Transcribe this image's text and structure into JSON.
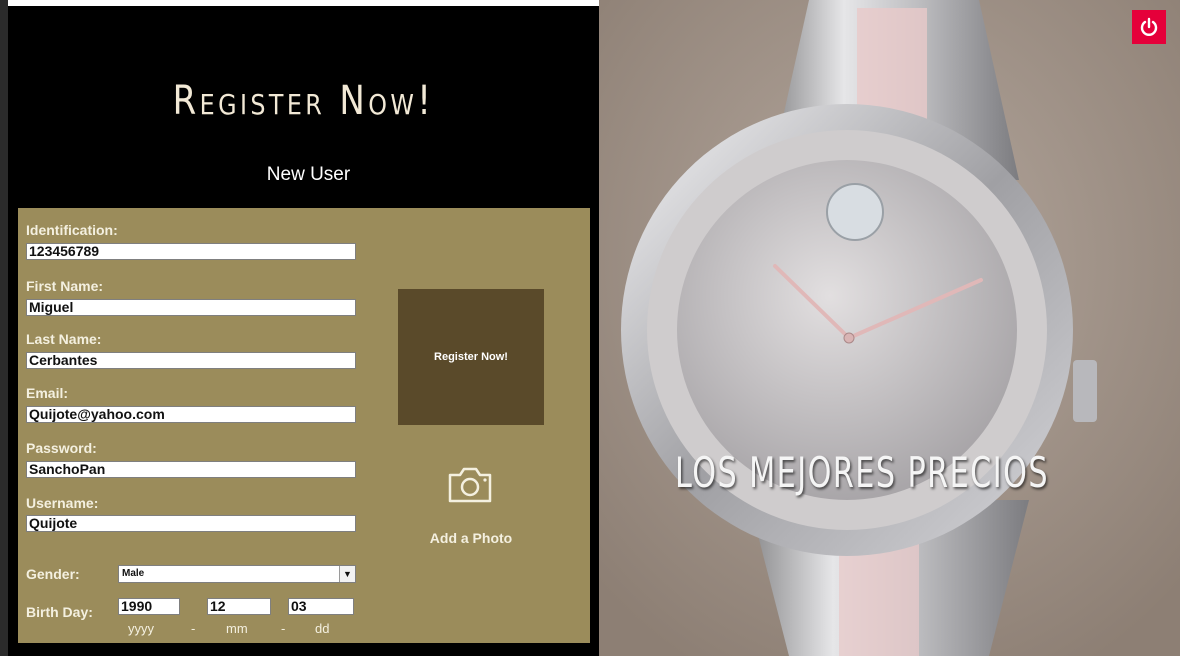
{
  "title": "Register Now!",
  "subtitle": "New User",
  "form": {
    "fields": [
      {
        "label": "Identification:",
        "value": "123456789"
      },
      {
        "label": "First Name:",
        "value": "Miguel"
      },
      {
        "label": "Last Name:",
        "value": "Cerbantes"
      },
      {
        "label": "Email:",
        "value": "Quijote@yahoo.com"
      },
      {
        "label": "Password:",
        "value": "SanchoPan"
      },
      {
        "label": "Username:",
        "value": "Quijote"
      }
    ],
    "gender": {
      "label": "Gender:",
      "value": "Male"
    },
    "birthday": {
      "label": "Birth Day:",
      "year": "1990",
      "month": "12",
      "day": "03",
      "year_hint": "yyyy",
      "month_hint": "mm",
      "day_hint": "dd",
      "separator": "-"
    },
    "register_button": "Register Now!",
    "add_photo": "Add a Photo"
  },
  "promo": {
    "text": "LOS MEJORES PRECIOS"
  },
  "colors": {
    "form_bg": "#9b8c5b",
    "button_bg": "#5a4a2a",
    "power_bg": "#e5003a"
  },
  "icons": {
    "camera": "camera-icon",
    "power": "power-icon",
    "dropdown": "chevron-down-icon"
  }
}
